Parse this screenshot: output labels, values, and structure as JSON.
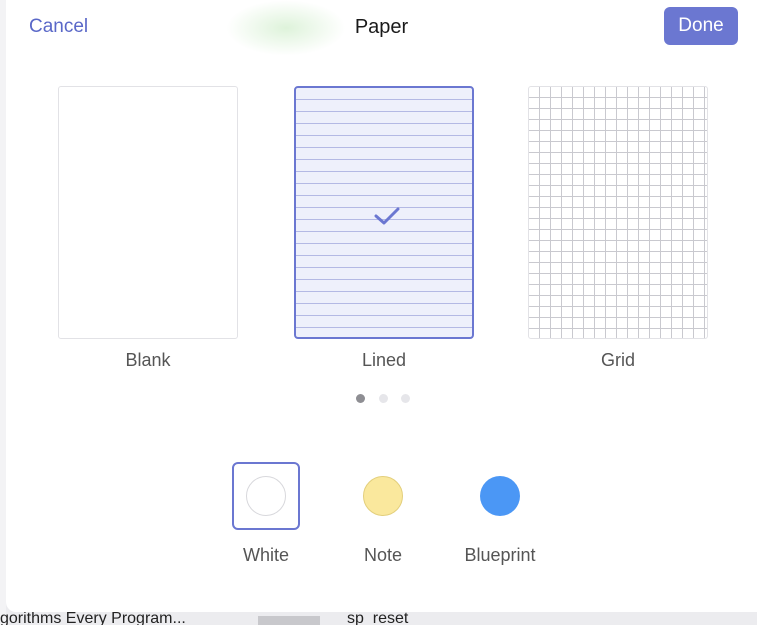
{
  "header": {
    "cancel_label": "Cancel",
    "title": "Paper",
    "done_label": "Done"
  },
  "papers": [
    {
      "label": "Blank",
      "selected": false
    },
    {
      "label": "Lined",
      "selected": true
    },
    {
      "label": "Grid",
      "selected": false
    }
  ],
  "pagination": {
    "current_page": 1,
    "total_pages": 3
  },
  "colors": [
    {
      "label": "White",
      "hex": "#ffffff",
      "selected": true
    },
    {
      "label": "Note",
      "hex": "#fae89d",
      "selected": false
    },
    {
      "label": "Blueprint",
      "hex": "#4b97f5",
      "selected": false
    }
  ],
  "background": {
    "bottom_left_text": "gorithms Every Program...",
    "bottom_mid_text": "sp_reset"
  },
  "theme": {
    "accent": "#6b77d1",
    "selected_fill": "#eef0fb"
  }
}
